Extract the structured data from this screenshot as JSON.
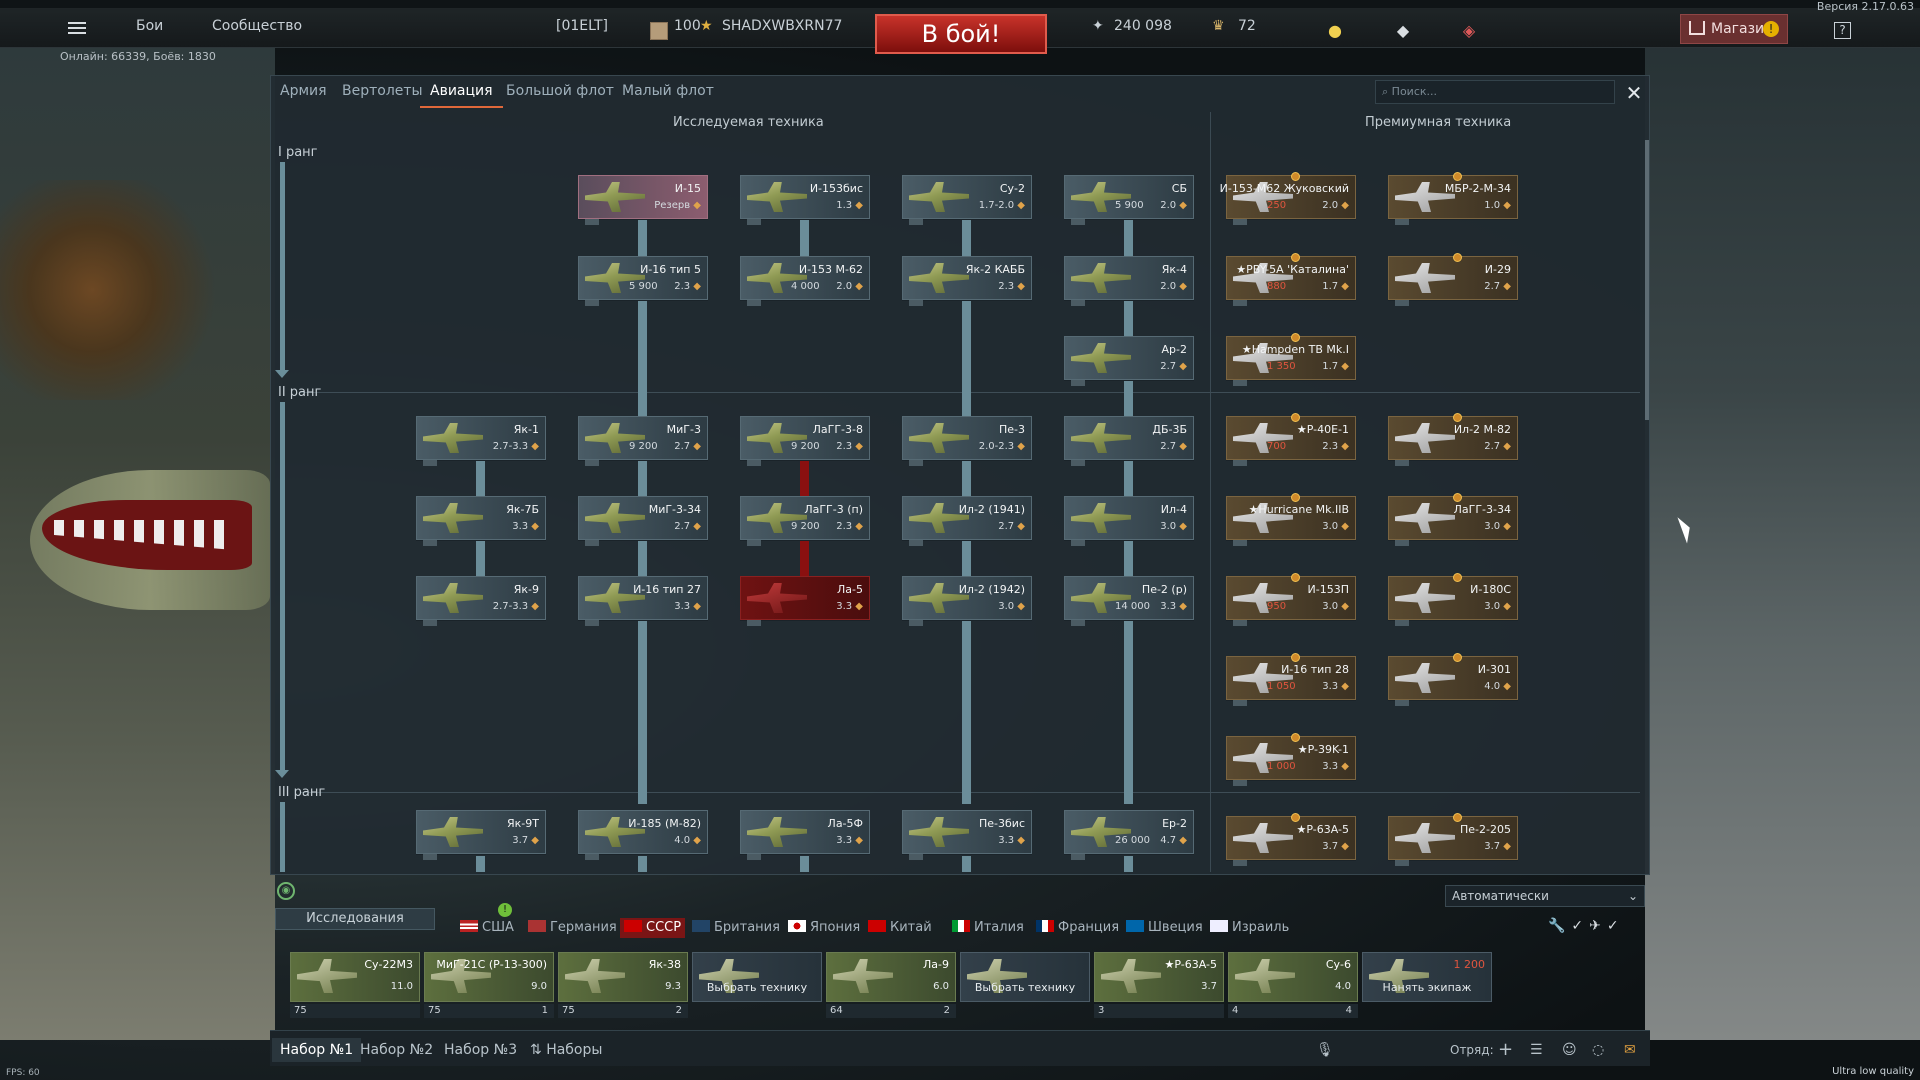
{
  "version": "Версия 2.17.0.63",
  "topbar": {
    "menu": [
      "Бои",
      "Сообщество"
    ],
    "clan": "[01ELT]",
    "level": "100",
    "nickname": "SHADXWBXRN77",
    "battle_button": "В бой!",
    "silver_lions": "240 098",
    "eagles": "72",
    "shop": "Магазин",
    "online": "Онлайн: 66339, Боёв: 1830",
    "help": "?"
  },
  "tabs": [
    "Армия",
    "Вертолеты",
    "Авиация",
    "Большой флот",
    "Малый флот"
  ],
  "active_tab": "Авиация",
  "search_placeholder": "Поиск...",
  "sections": {
    "researched": "Исследуемая техника",
    "premium": "Премиумная техника"
  },
  "ranks": [
    "I ранг",
    "II ранг",
    "III ранг"
  ],
  "tree": [
    {
      "name": "И-15",
      "br": "Резерв",
      "type": "res"
    },
    {
      "name": "И-153бис",
      "br": "1.3",
      "type": ""
    },
    {
      "name": "Су-2",
      "br": "1.7-2.0",
      "type": ""
    },
    {
      "name": "СБ",
      "rp": "5 900",
      "br": "2.0",
      "type": ""
    },
    {
      "name": "И-16 тип 5",
      "rp": "5 900",
      "br": "2.3",
      "type": ""
    },
    {
      "name": "И-153 М-62",
      "rp": "4 000",
      "br": "2.0",
      "type": ""
    },
    {
      "name": "Як-2 КАББ",
      "br": "2.3",
      "type": ""
    },
    {
      "name": "Як-4",
      "br": "2.0",
      "type": ""
    },
    {
      "name": "Ар-2",
      "br": "2.7",
      "type": ""
    },
    {
      "name": "Як-1",
      "br": "2.7-3.3",
      "type": ""
    },
    {
      "name": "МиГ-3",
      "rp": "9 200",
      "br": "2.7",
      "type": ""
    },
    {
      "name": "ЛаГГ-3-8",
      "rp": "9 200",
      "br": "2.3",
      "type": ""
    },
    {
      "name": "Пе-3",
      "br": "2.0-2.3",
      "type": ""
    },
    {
      "name": "ДБ-3Б",
      "br": "2.7",
      "type": ""
    },
    {
      "name": "Як-7Б",
      "br": "3.3",
      "type": ""
    },
    {
      "name": "МиГ-3-34",
      "br": "2.7",
      "type": ""
    },
    {
      "name": "ЛаГГ-3 (п)",
      "rp": "9 200",
      "br": "2.3",
      "type": ""
    },
    {
      "name": "Ил-2 (1941)",
      "br": "2.7",
      "type": ""
    },
    {
      "name": "Ил-4",
      "br": "3.0",
      "type": ""
    },
    {
      "name": "Як-9",
      "br": "2.7-3.3",
      "type": ""
    },
    {
      "name": "И-16 тип 27",
      "br": "3.3",
      "type": ""
    },
    {
      "name": "Ла-5",
      "br": "3.3",
      "type": "lock"
    },
    {
      "name": "Ил-2 (1942)",
      "br": "3.0",
      "type": ""
    },
    {
      "name": "Пе-2 (р)",
      "rp": "14 000",
      "br": "3.3",
      "type": ""
    },
    {
      "name": "Як-9Т",
      "br": "3.7",
      "type": ""
    },
    {
      "name": "И-185 (М-82)",
      "br": "4.0",
      "type": ""
    },
    {
      "name": "Ла-5Ф",
      "br": "3.3",
      "type": ""
    },
    {
      "name": "Пе-3бис",
      "br": "3.3",
      "type": ""
    },
    {
      "name": "Ер-2",
      "rp": "26 000",
      "br": "4.7",
      "type": ""
    }
  ],
  "premium": [
    {
      "name": "И-153-М62 Жуковский",
      "cost": "250",
      "br": "2.0"
    },
    {
      "name": "МБР-2-М-34",
      "br": "1.0"
    },
    {
      "name": "★PBY-5A 'Каталина'",
      "cost": "880",
      "br": "1.7"
    },
    {
      "name": "И-29",
      "br": "2.7"
    },
    {
      "name": "★Hampden TB Mk.I",
      "cost": "1 350",
      "br": "1.7"
    },
    {
      "name": "★P-40E-1",
      "cost": "700",
      "br": "2.3"
    },
    {
      "name": "Ил-2 М-82",
      "br": "2.7"
    },
    {
      "name": "★Hurricane Mk.IIB",
      "br": "3.0"
    },
    {
      "name": "ЛаГГ-3-34",
      "br": "3.0"
    },
    {
      "name": "И-153П",
      "cost": "950",
      "br": "3.0"
    },
    {
      "name": "И-180С",
      "br": "3.0"
    },
    {
      "name": "И-16 тип 28",
      "cost": "1 050",
      "br": "3.3"
    },
    {
      "name": "И-301",
      "br": "4.0"
    },
    {
      "name": "★P-39K-1",
      "cost": "1 000",
      "br": "3.3"
    },
    {
      "name": "★P-63A-5",
      "br": "3.7"
    },
    {
      "name": "Пе-2-205",
      "br": "3.7"
    }
  ],
  "research_label": "Исследования",
  "auto_select": "Автоматически",
  "nations": [
    "США",
    "Германия",
    "СССР",
    "Британия",
    "Япония",
    "Китай",
    "Италия",
    "Франция",
    "Швеция",
    "Израиль"
  ],
  "active_nation": "СССР",
  "crew": [
    {
      "name": "Су-22М3",
      "br": "11.0",
      "count": "75"
    },
    {
      "name": "МиГ-21С (Р-13-300)",
      "br": "9.0",
      "count": "75",
      "slot": "1"
    },
    {
      "name": "Як-38",
      "br": "9.3",
      "count": "75",
      "slot": "2"
    },
    {
      "name": "",
      "mid": "Выбрать технику",
      "count": ""
    },
    {
      "name": "Ла-9",
      "br": "6.0",
      "count": "64",
      "slot": "2"
    },
    {
      "name": "",
      "mid": "Выбрать технику",
      "count": ""
    },
    {
      "name": "★P-63A-5",
      "br": "3.7",
      "count": "3"
    },
    {
      "name": "Су-6",
      "br": "4.0",
      "count": "4",
      "slot": "4"
    },
    {
      "name": "",
      "mid": "Нанять экипаж",
      "cost": "1 200",
      "count": ""
    }
  ],
  "presets": [
    "Набор №1",
    "Набор №2",
    "Набор №3",
    "Наборы"
  ],
  "squad_label": "Отряд:",
  "fps": "FPS: 60",
  "quality": "Ultra low quality",
  "colors": {
    "accent": "#e0683a",
    "battle": "#c8332a",
    "active_nation": "#7a1515"
  }
}
